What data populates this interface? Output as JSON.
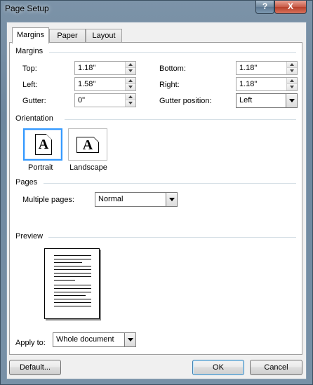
{
  "window": {
    "title": "Page Setup",
    "help_label": "?",
    "close_label": "X"
  },
  "tabs": [
    {
      "label": "Margins",
      "active": true
    },
    {
      "label": "Paper",
      "active": false
    },
    {
      "label": "Layout",
      "active": false
    }
  ],
  "margins": {
    "section_label": "Margins",
    "top": {
      "label": "Top:",
      "value": "1.18\""
    },
    "bottom": {
      "label": "Bottom:",
      "value": "1.18\""
    },
    "left": {
      "label": "Left:",
      "value": "1.58\""
    },
    "right": {
      "label": "Right:",
      "value": "1.18\""
    },
    "gutter": {
      "label": "Gutter:",
      "value": "0\""
    },
    "gutter_position": {
      "label": "Gutter position:",
      "value": "Left"
    }
  },
  "orientation": {
    "section_label": "Orientation",
    "portrait_label": "Portrait",
    "landscape_label": "Landscape",
    "icon_letter": "A",
    "selected": "portrait"
  },
  "pages": {
    "section_label": "Pages",
    "multiple_pages_label": "Multiple pages:",
    "multiple_pages_value": "Normal"
  },
  "preview": {
    "section_label": "Preview"
  },
  "apply_to": {
    "label": "Apply to:",
    "value": "Whole document"
  },
  "buttons": {
    "default": "Default...",
    "ok": "OK",
    "cancel": "Cancel"
  },
  "colors": {
    "selection_border": "#3399ff",
    "title_bar": "#7c93a8",
    "close_button": "#c75a47"
  }
}
